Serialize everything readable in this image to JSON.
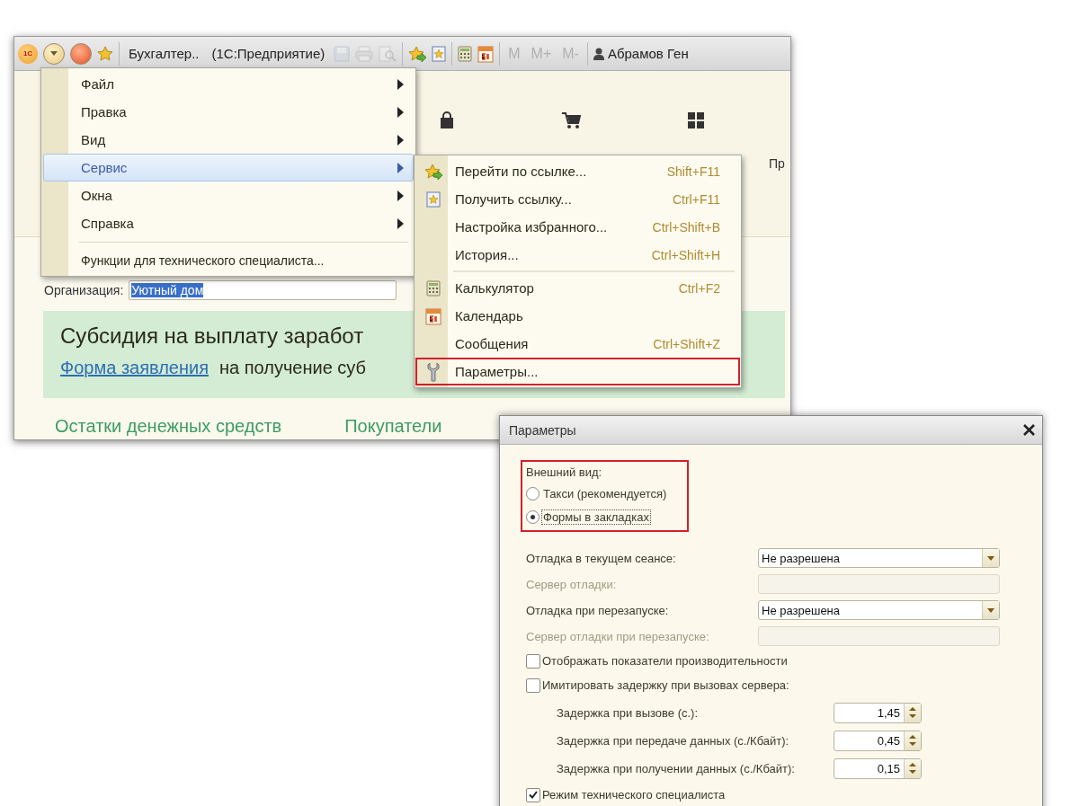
{
  "main_window": {
    "toolbar": {
      "logo": "1С",
      "left_buttons": [
        {
          "kind": "menu"
        },
        {
          "kind": "close"
        },
        {
          "kind": "favorite"
        }
      ],
      "title": "Бухгалтер..",
      "app": "(1С:Предприятие)",
      "tools": [
        {
          "kind": "save",
          "disabled": true
        },
        {
          "kind": "print",
          "disabled": true
        },
        {
          "kind": "preview",
          "disabled": true
        },
        {
          "kind": "goto-link",
          "disabled": false
        },
        {
          "kind": "get-link",
          "disabled": false
        },
        {
          "kind": "calculator",
          "disabled": false
        },
        {
          "kind": "calendar",
          "disabled": false
        }
      ],
      "memory": [
        {
          "label": "M",
          "disabled": true
        },
        {
          "label": "M+",
          "disabled": true
        },
        {
          "label": "M-",
          "disabled": true
        }
      ],
      "user": "Абрамов Ген"
    },
    "sections": [
      {
        "kind": "bag"
      },
      {
        "kind": "cart"
      },
      {
        "kind": "grid"
      }
    ],
    "section_label": "Пр",
    "form": {
      "organization_label": "Организация:",
      "organization_value": "Уютный дом",
      "banner": {
        "title": "Субсидия на выплату заработ",
        "link": "Форма заявления",
        "text": "на получение суб"
      },
      "links": [
        "Остатки денежных средств",
        "Покупатели"
      ]
    }
  },
  "main_menu": {
    "items": [
      {
        "label": "Файл",
        "selected": false
      },
      {
        "label": "Правка",
        "selected": false
      },
      {
        "label": "Вид",
        "selected": false
      },
      {
        "label": "Сервис",
        "selected": true
      },
      {
        "label": "Окна",
        "selected": false
      },
      {
        "label": "Справка",
        "selected": false
      }
    ],
    "footer_item": "Функции для технического специалиста..."
  },
  "service_menu": {
    "items": [
      {
        "kind": "goto-link",
        "label": "Перейти по ссылке...",
        "shortcut": "Shift+F11",
        "separator_before": false,
        "annotated": false
      },
      {
        "kind": "get-link",
        "label": "Получить ссылку...",
        "shortcut": "Ctrl+F11",
        "separator_before": false,
        "annotated": false
      },
      {
        "kind": "plain",
        "label": "Настройка избранного...",
        "shortcut": "Ctrl+Shift+B",
        "separator_before": false,
        "annotated": false
      },
      {
        "kind": "plain",
        "label": "История...",
        "shortcut": "Ctrl+Shift+H",
        "separator_before": false,
        "annotated": false
      },
      {
        "kind": "calculator",
        "label": "Калькулятор",
        "shortcut": "Ctrl+F2",
        "separator_before": true,
        "annotated": false
      },
      {
        "kind": "calendar",
        "label": "Календарь",
        "separator_before": false,
        "annotated": false
      },
      {
        "kind": "plain",
        "label": "Сообщения",
        "shortcut": "Ctrl+Shift+Z",
        "separator_before": false,
        "annotated": false
      },
      {
        "kind": "wrench",
        "label": "Параметры...",
        "separator_before": false,
        "annotated": true
      }
    ]
  },
  "dialog": {
    "title": "Параметры",
    "appearance": {
      "label": "Внешний вид:",
      "annotated": true,
      "options": [
        {
          "label": "Такси (рекомендуется)",
          "selected": false,
          "focused": false
        },
        {
          "label": "Формы в закладках",
          "selected": true,
          "focused": true
        }
      ]
    },
    "fields": [
      {
        "label": "Отладка в текущем сеансе:",
        "kind": "select",
        "value": "Не разрешена",
        "disabled": false
      },
      {
        "label": "Сервер отладки:",
        "kind": "text",
        "disabled": true
      },
      {
        "label": "Отладка при перезапуске:",
        "kind": "select",
        "value": "Не разрешена",
        "disabled": false
      },
      {
        "label": "Сервер отладки при перезапуске:",
        "kind": "text",
        "disabled": true
      }
    ],
    "checkboxes": [
      {
        "label": "Отображать показатели производительности",
        "checked": false
      },
      {
        "label": "Имитировать задержку при вызовах сервера:",
        "checked": false,
        "children": [
          {
            "label": "Задержка при вызове (с.):",
            "kind": "number",
            "value": "1,45"
          },
          {
            "label": "Задержка при передаче данных (с./Кбайт):",
            "kind": "number",
            "value": "0,45"
          },
          {
            "label": "Задержка при получении данных (с./Кбайт):",
            "kind": "number",
            "value": "0,15"
          }
        ]
      },
      {
        "label": "Режим технического специалиста",
        "checked": true
      }
    ]
  }
}
